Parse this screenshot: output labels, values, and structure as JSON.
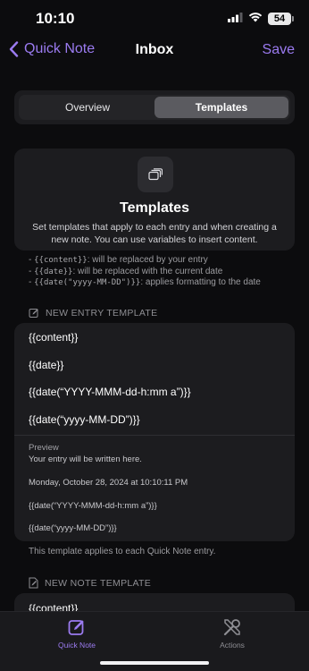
{
  "status": {
    "time": "10:10",
    "battery": "54"
  },
  "nav": {
    "back_label": "Quick Note",
    "title": "Inbox",
    "save_label": "Save"
  },
  "segments": {
    "overview": "Overview",
    "templates": "Templates"
  },
  "header": {
    "title": "Templates",
    "description": "Set templates that apply to each entry and when creating a new note. You can use variables to insert content."
  },
  "variables": [
    {
      "code": "{{content}}",
      "desc": ": will be replaced by your entry"
    },
    {
      "code": "{{date}}",
      "desc": ": will be replaced with the current date"
    },
    {
      "code": "{{date(\"yyyy-MM-DD\")}}",
      "desc": ": applies formatting to the date"
    }
  ],
  "entry_section": {
    "label": "NEW ENTRY TEMPLATE",
    "lines": [
      "{{content}}",
      "{{date}}",
      "{{date(“YYYY-MMM-dd-h:mm a”)}}",
      "{{date(“yyyy-MM-DD”)}}"
    ],
    "preview_label": "Preview",
    "preview_lines": [
      "Your entry will be written here.",
      "Monday, October 28, 2024 at 10:10:11 PM",
      "{{date(“YYYY-MMM-dd-h:mm a”)}}",
      "{{date(“yyyy-MM-DD”)}}"
    ]
  },
  "entry_note": "This template applies to each Quick Note entry.",
  "note_section": {
    "label": "NEW NOTE TEMPLATE",
    "first_line": "{{content}}"
  },
  "tabs": {
    "quick_note": "Quick Note",
    "actions": "Actions"
  },
  "colors": {
    "accent": "#9b7bf0",
    "background": "#0c0c0e",
    "card": "#1c1c1f"
  }
}
